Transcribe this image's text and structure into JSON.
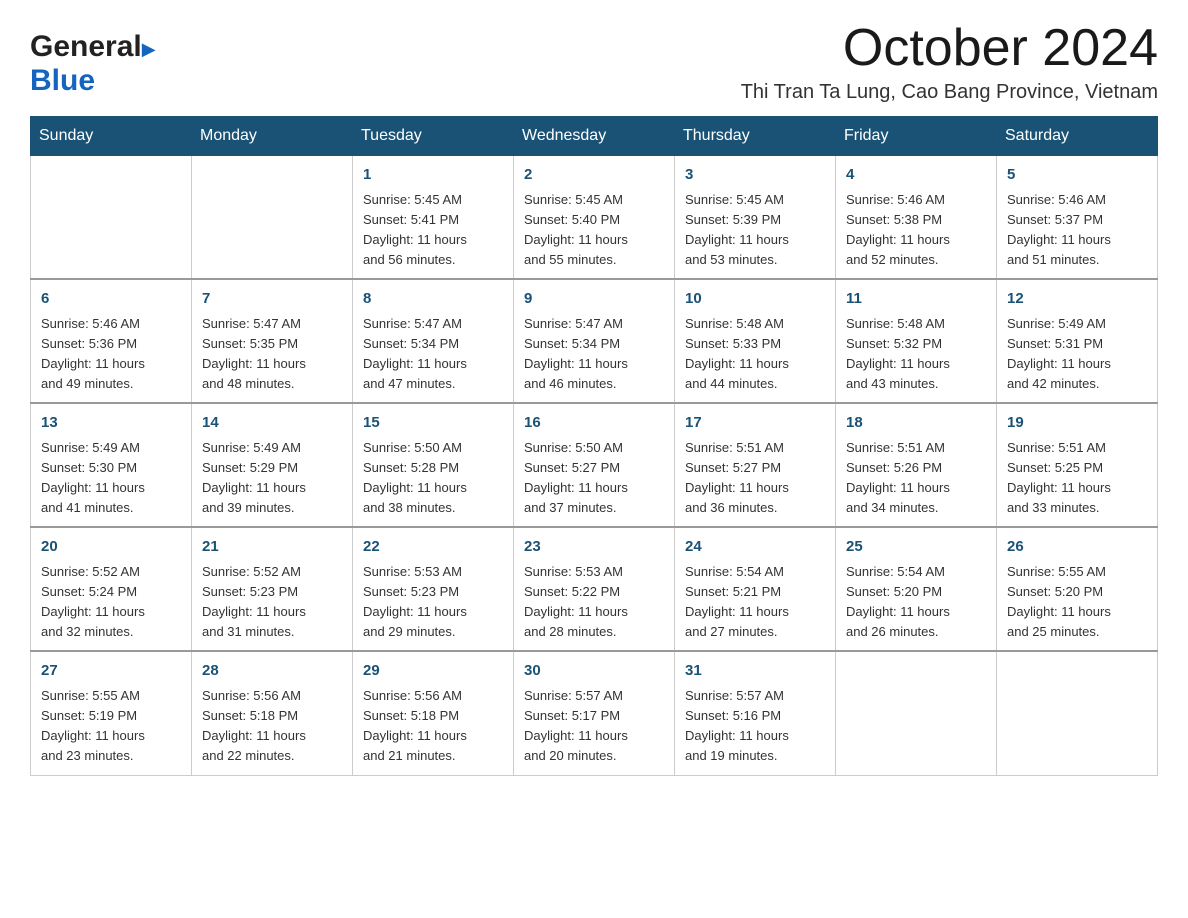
{
  "logo": {
    "general": "General",
    "blue": "Blue"
  },
  "title": "October 2024",
  "subtitle": "Thi Tran Ta Lung, Cao Bang Province, Vietnam",
  "weekdays": [
    "Sunday",
    "Monday",
    "Tuesday",
    "Wednesday",
    "Thursday",
    "Friday",
    "Saturday"
  ],
  "weeks": [
    [
      {
        "day": "",
        "info": ""
      },
      {
        "day": "",
        "info": ""
      },
      {
        "day": "1",
        "info": "Sunrise: 5:45 AM\nSunset: 5:41 PM\nDaylight: 11 hours\nand 56 minutes."
      },
      {
        "day": "2",
        "info": "Sunrise: 5:45 AM\nSunset: 5:40 PM\nDaylight: 11 hours\nand 55 minutes."
      },
      {
        "day": "3",
        "info": "Sunrise: 5:45 AM\nSunset: 5:39 PM\nDaylight: 11 hours\nand 53 minutes."
      },
      {
        "day": "4",
        "info": "Sunrise: 5:46 AM\nSunset: 5:38 PM\nDaylight: 11 hours\nand 52 minutes."
      },
      {
        "day": "5",
        "info": "Sunrise: 5:46 AM\nSunset: 5:37 PM\nDaylight: 11 hours\nand 51 minutes."
      }
    ],
    [
      {
        "day": "6",
        "info": "Sunrise: 5:46 AM\nSunset: 5:36 PM\nDaylight: 11 hours\nand 49 minutes."
      },
      {
        "day": "7",
        "info": "Sunrise: 5:47 AM\nSunset: 5:35 PM\nDaylight: 11 hours\nand 48 minutes."
      },
      {
        "day": "8",
        "info": "Sunrise: 5:47 AM\nSunset: 5:34 PM\nDaylight: 11 hours\nand 47 minutes."
      },
      {
        "day": "9",
        "info": "Sunrise: 5:47 AM\nSunset: 5:34 PM\nDaylight: 11 hours\nand 46 minutes."
      },
      {
        "day": "10",
        "info": "Sunrise: 5:48 AM\nSunset: 5:33 PM\nDaylight: 11 hours\nand 44 minutes."
      },
      {
        "day": "11",
        "info": "Sunrise: 5:48 AM\nSunset: 5:32 PM\nDaylight: 11 hours\nand 43 minutes."
      },
      {
        "day": "12",
        "info": "Sunrise: 5:49 AM\nSunset: 5:31 PM\nDaylight: 11 hours\nand 42 minutes."
      }
    ],
    [
      {
        "day": "13",
        "info": "Sunrise: 5:49 AM\nSunset: 5:30 PM\nDaylight: 11 hours\nand 41 minutes."
      },
      {
        "day": "14",
        "info": "Sunrise: 5:49 AM\nSunset: 5:29 PM\nDaylight: 11 hours\nand 39 minutes."
      },
      {
        "day": "15",
        "info": "Sunrise: 5:50 AM\nSunset: 5:28 PM\nDaylight: 11 hours\nand 38 minutes."
      },
      {
        "day": "16",
        "info": "Sunrise: 5:50 AM\nSunset: 5:27 PM\nDaylight: 11 hours\nand 37 minutes."
      },
      {
        "day": "17",
        "info": "Sunrise: 5:51 AM\nSunset: 5:27 PM\nDaylight: 11 hours\nand 36 minutes."
      },
      {
        "day": "18",
        "info": "Sunrise: 5:51 AM\nSunset: 5:26 PM\nDaylight: 11 hours\nand 34 minutes."
      },
      {
        "day": "19",
        "info": "Sunrise: 5:51 AM\nSunset: 5:25 PM\nDaylight: 11 hours\nand 33 minutes."
      }
    ],
    [
      {
        "day": "20",
        "info": "Sunrise: 5:52 AM\nSunset: 5:24 PM\nDaylight: 11 hours\nand 32 minutes."
      },
      {
        "day": "21",
        "info": "Sunrise: 5:52 AM\nSunset: 5:23 PM\nDaylight: 11 hours\nand 31 minutes."
      },
      {
        "day": "22",
        "info": "Sunrise: 5:53 AM\nSunset: 5:23 PM\nDaylight: 11 hours\nand 29 minutes."
      },
      {
        "day": "23",
        "info": "Sunrise: 5:53 AM\nSunset: 5:22 PM\nDaylight: 11 hours\nand 28 minutes."
      },
      {
        "day": "24",
        "info": "Sunrise: 5:54 AM\nSunset: 5:21 PM\nDaylight: 11 hours\nand 27 minutes."
      },
      {
        "day": "25",
        "info": "Sunrise: 5:54 AM\nSunset: 5:20 PM\nDaylight: 11 hours\nand 26 minutes."
      },
      {
        "day": "26",
        "info": "Sunrise: 5:55 AM\nSunset: 5:20 PM\nDaylight: 11 hours\nand 25 minutes."
      }
    ],
    [
      {
        "day": "27",
        "info": "Sunrise: 5:55 AM\nSunset: 5:19 PM\nDaylight: 11 hours\nand 23 minutes."
      },
      {
        "day": "28",
        "info": "Sunrise: 5:56 AM\nSunset: 5:18 PM\nDaylight: 11 hours\nand 22 minutes."
      },
      {
        "day": "29",
        "info": "Sunrise: 5:56 AM\nSunset: 5:18 PM\nDaylight: 11 hours\nand 21 minutes."
      },
      {
        "day": "30",
        "info": "Sunrise: 5:57 AM\nSunset: 5:17 PM\nDaylight: 11 hours\nand 20 minutes."
      },
      {
        "day": "31",
        "info": "Sunrise: 5:57 AM\nSunset: 5:16 PM\nDaylight: 11 hours\nand 19 minutes."
      },
      {
        "day": "",
        "info": ""
      },
      {
        "day": "",
        "info": ""
      }
    ]
  ]
}
